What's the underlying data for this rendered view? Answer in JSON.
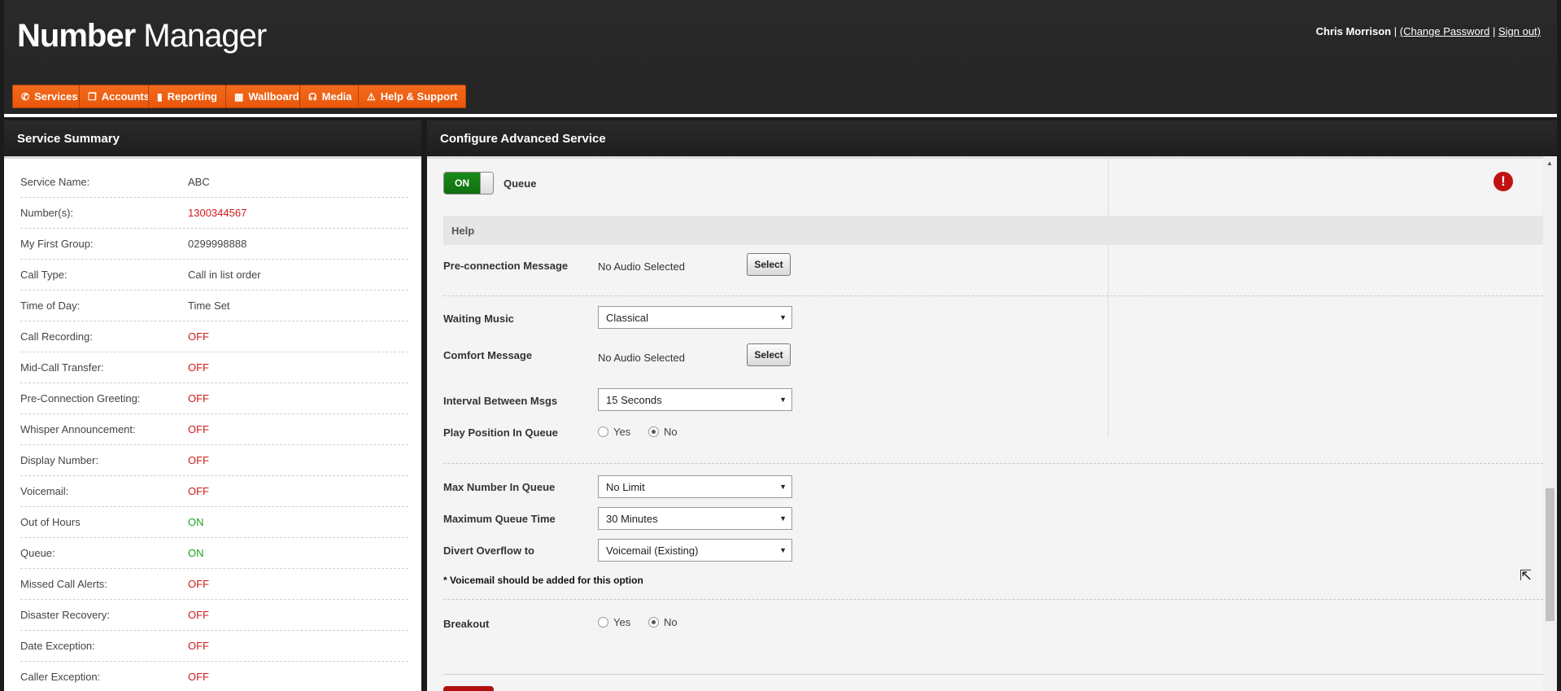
{
  "header": {
    "logo_bold": "Number",
    "logo_light": "Manager",
    "user_name": "Chris Morrison",
    "sep1": "|",
    "change_password": "(Change Password",
    "sep2": "|",
    "sign_out": "Sign out)"
  },
  "nav": {
    "items": [
      {
        "label": "Services",
        "icon": "phone-icon",
        "glyph": "✆"
      },
      {
        "label": "Accounts",
        "icon": "document-icon",
        "glyph": "❐"
      },
      {
        "label": "Reporting",
        "icon": "bar-chart-icon",
        "glyph": "▮"
      },
      {
        "label": "Wallboard",
        "icon": "grid-icon",
        "glyph": "▦"
      },
      {
        "label": "Media",
        "icon": "headphones-icon",
        "glyph": "☊"
      },
      {
        "label": "Help & Support",
        "icon": "warning-icon",
        "glyph": "⚠"
      }
    ]
  },
  "left_panel": {
    "title": "Service Summary",
    "rows": [
      {
        "key": "Service Name:",
        "value": "ABC",
        "color": "normal"
      },
      {
        "key": "Number(s):",
        "value": "1300344567",
        "color": "red"
      },
      {
        "key": "My First Group:",
        "value": "0299998888",
        "color": "normal"
      },
      {
        "key": "Call Type:",
        "value": "Call in list order",
        "color": "normal"
      },
      {
        "key": "Time of Day:",
        "value": "Time Set",
        "color": "normal"
      },
      {
        "key": "Call Recording:",
        "value": "OFF",
        "color": "red"
      },
      {
        "key": "Mid-Call Transfer:",
        "value": "OFF",
        "color": "red"
      },
      {
        "key": "Pre-Connection Greeting:",
        "value": "OFF",
        "color": "red"
      },
      {
        "key": "Whisper Announcement:",
        "value": "OFF",
        "color": "red"
      },
      {
        "key": "Display Number:",
        "value": "OFF",
        "color": "red"
      },
      {
        "key": "Voicemail:",
        "value": "OFF",
        "color": "red"
      },
      {
        "key": "Out of Hours",
        "value": "ON",
        "color": "green"
      },
      {
        "key": "Queue:",
        "value": "ON",
        "color": "green"
      },
      {
        "key": "Missed Call Alerts:",
        "value": "OFF",
        "color": "red"
      },
      {
        "key": "Disaster Recovery:",
        "value": "OFF",
        "color": "red"
      },
      {
        "key": "Date Exception:",
        "value": "OFF",
        "color": "red"
      },
      {
        "key": "Caller Exception:",
        "value": "OFF",
        "color": "red"
      }
    ]
  },
  "right_panel": {
    "title": "Configure Advanced Service",
    "toggle_state": "ON",
    "toggle_label": "Queue",
    "help": "Help",
    "alert_glyph": "!",
    "preconnection": {
      "label": "Pre-connection Message",
      "value": "No Audio Selected",
      "button": "Select"
    },
    "waiting_music": {
      "label": "Waiting Music",
      "value": "Classical"
    },
    "comfort": {
      "label": "Comfort Message",
      "value": "No Audio Selected",
      "button": "Select"
    },
    "interval": {
      "label": "Interval Between Msgs",
      "value": "15 Seconds"
    },
    "play_position": {
      "label": "Play Position In Queue",
      "yes": "Yes",
      "no": "No",
      "selected": "No"
    },
    "max_number": {
      "label": "Max Number In Queue",
      "value": "No Limit"
    },
    "max_time": {
      "label": "Maximum Queue Time",
      "value": "30 Minutes"
    },
    "divert": {
      "label": "Divert Overflow to",
      "value": "Voicemail (Existing)"
    },
    "note": "* Voicemail should be added for this option",
    "breakout": {
      "label": "Breakout",
      "yes": "Yes",
      "no": "No",
      "selected": "No"
    }
  }
}
